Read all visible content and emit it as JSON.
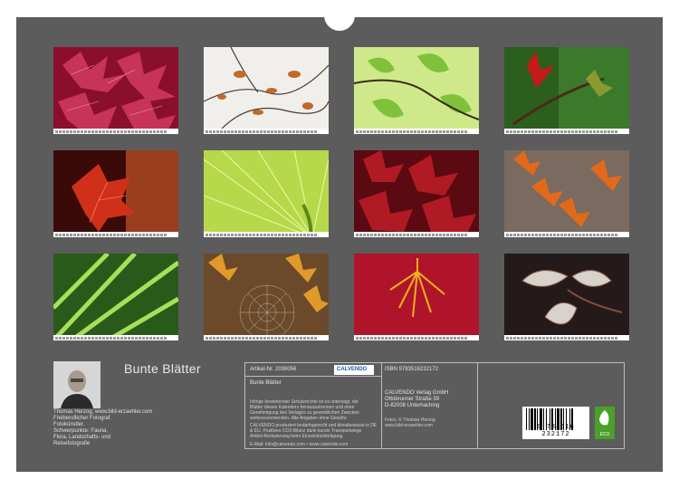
{
  "title": "Bunte Blätter",
  "thumbnails": [
    {
      "name": "red-maple-leaves-macro"
    },
    {
      "name": "autumn-leaves-on-white"
    },
    {
      "name": "green-ginkgo-leaves"
    },
    {
      "name": "red-leaf-on-branch"
    },
    {
      "name": "red-leaf-backlit"
    },
    {
      "name": "green-leaf-veins"
    },
    {
      "name": "red-maple-leaves"
    },
    {
      "name": "orange-maple-leaves"
    },
    {
      "name": "green-grass-blades"
    },
    {
      "name": "spider-web-autumn"
    },
    {
      "name": "yellow-leaves-on-red"
    },
    {
      "name": "frosted-leaves"
    }
  ],
  "author": {
    "line1": "Thomas Herzog, www.bild-erzaehler.com",
    "line2": "Freiberuflicher Fotograf.",
    "line3": "Fotokünstler.",
    "line4": "Schwerpunkte: Fauna,",
    "line5": "Flora, Landschafts- und",
    "line6": "Reisefotografie"
  },
  "info": {
    "artikel": "Artikel-Nr. 2038056",
    "product_title": "Bunte Blätter",
    "rights_text_1": "Infolge bestehender Schutzrechte ist es untersagt, die",
    "rights_text_2": "Blätter dieses Kalenders herauszutrennen und ohne",
    "rights_text_3": "Genehmigung des Verlages zu gewerblichen Zwecken",
    "rights_text_4": "weiterzuverwenden. Alle Angaben ohne Gewähr.",
    "climate_text_1": "CALVENDO produziert bedarfsgerecht und klimabewusst in DE",
    "climate_text_2": "& EU. Positives CO2-Bilanz dank kurzer Transportwege",
    "climate_text_3": "Artikel-Reduzierung beim Einzelstückfertigung.",
    "contact": "E-Mail: info@calvendo.com • www.calvendo.com",
    "calvendo_logo": "CALVENDO",
    "isbn": "ISBN 9783516232172",
    "publisher_1": "CALVENDO Verlag GmbH",
    "publisher_2": "Ottobrunner Straße 39",
    "publisher_3": "D-82008 Unterhaching",
    "credits_1": "Fotos: © Thomas Herzog",
    "credits_2": "www.bild-erzaehler.com",
    "barcode_number": "9 783516 232172",
    "eco_label": "ECO"
  }
}
